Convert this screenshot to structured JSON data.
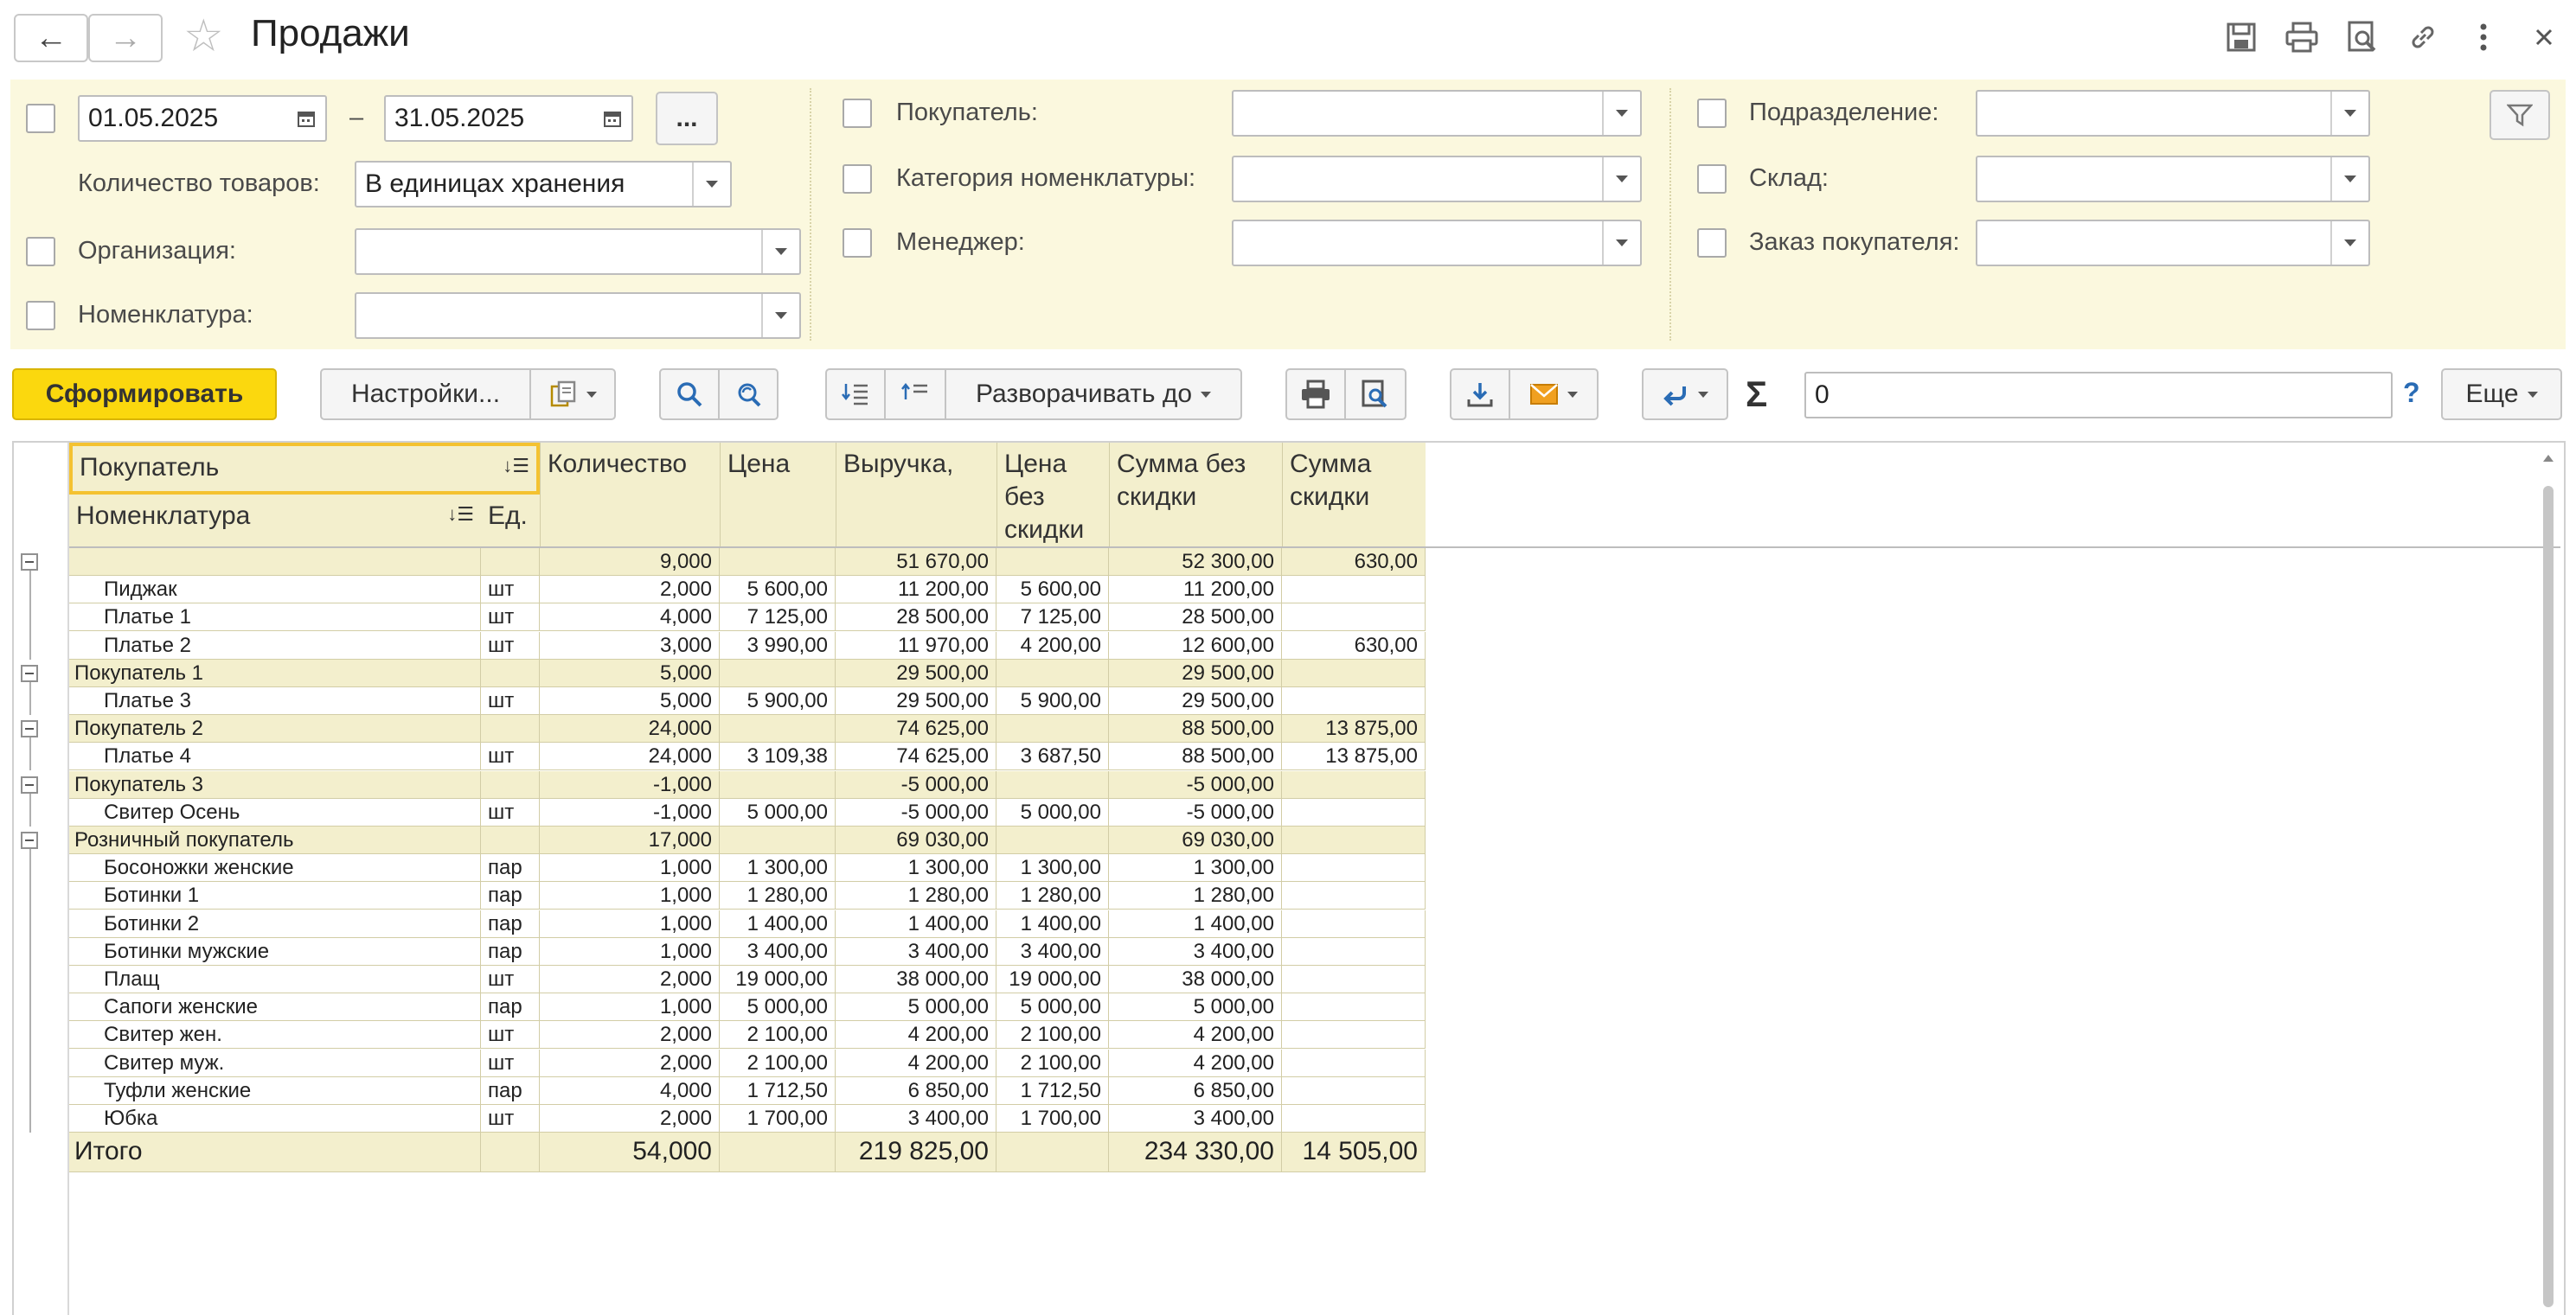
{
  "window": {
    "title": "Продажи"
  },
  "filters": {
    "period_from": "01.05.2025",
    "period_dash": "–",
    "period_to": "31.05.2025",
    "period_more": "...",
    "qty_label": "Количество товаров:",
    "qty_value": "В единицах хранения",
    "org_label": "Организация:",
    "org_value": "",
    "nom_label": "Номенклатура:",
    "nom_value": "",
    "buyer_label": "Покупатель:",
    "buyer_value": "",
    "category_label": "Категория номенклатуры:",
    "category_value": "",
    "manager_label": "Менеджер:",
    "manager_value": "",
    "division_label": "Подразделение:",
    "division_value": "",
    "warehouse_label": "Склад:",
    "warehouse_value": "",
    "order_label": "Заказ покупателя:",
    "order_value": ""
  },
  "toolbar": {
    "generate": "Сформировать",
    "settings": "Настройки...",
    "expand_to": "Разворачивать до",
    "sigma": "Σ",
    "sum_value": "0",
    "help": "?",
    "more": "Еще"
  },
  "report": {
    "headers": {
      "buyer": "Покупатель",
      "nomenclature": "Номенклатура",
      "unit": "Ед.",
      "qty": "Количество",
      "price": "Цена",
      "revenue": "Выручка,",
      "price_no_discount_1": "Цена",
      "price_no_discount_2": "без",
      "price_no_discount_3": "скидки",
      "sum_no_discount_1": "Сумма без",
      "sum_no_discount_2": "скидки",
      "discount_1": "Сумма",
      "discount_2": "скидки"
    },
    "rows": [
      {
        "type": "group",
        "name": "",
        "unit": "",
        "qty": "9,000",
        "price": "",
        "revenue": "51 670,00",
        "price_nd": "",
        "sum_nd": "52 300,00",
        "discount": "630,00"
      },
      {
        "type": "item",
        "name": "Пиджак",
        "unit": "шт",
        "qty": "2,000",
        "price": "5 600,00",
        "revenue": "11 200,00",
        "price_nd": "5 600,00",
        "sum_nd": "11 200,00",
        "discount": ""
      },
      {
        "type": "item",
        "name": "Платье 1",
        "unit": "шт",
        "qty": "4,000",
        "price": "7 125,00",
        "revenue": "28 500,00",
        "price_nd": "7 125,00",
        "sum_nd": "28 500,00",
        "discount": ""
      },
      {
        "type": "item",
        "name": "Платье 2",
        "unit": "шт",
        "qty": "3,000",
        "price": "3 990,00",
        "revenue": "11 970,00",
        "price_nd": "4 200,00",
        "sum_nd": "12 600,00",
        "discount": "630,00"
      },
      {
        "type": "group",
        "name": "Покупатель 1",
        "unit": "",
        "qty": "5,000",
        "price": "",
        "revenue": "29 500,00",
        "price_nd": "",
        "sum_nd": "29 500,00",
        "discount": ""
      },
      {
        "type": "item",
        "name": "Платье 3",
        "unit": "шт",
        "qty": "5,000",
        "price": "5 900,00",
        "revenue": "29 500,00",
        "price_nd": "5 900,00",
        "sum_nd": "29 500,00",
        "discount": ""
      },
      {
        "type": "group",
        "name": "Покупатель 2",
        "unit": "",
        "qty": "24,000",
        "price": "",
        "revenue": "74 625,00",
        "price_nd": "",
        "sum_nd": "88 500,00",
        "discount": "13 875,00"
      },
      {
        "type": "item",
        "name": "Платье 4",
        "unit": "шт",
        "qty": "24,000",
        "price": "3 109,38",
        "revenue": "74 625,00",
        "price_nd": "3 687,50",
        "sum_nd": "88 500,00",
        "discount": "13 875,00"
      },
      {
        "type": "group",
        "name": "Покупатель 3",
        "unit": "",
        "qty": "-1,000",
        "price": "",
        "revenue": "-5 000,00",
        "price_nd": "",
        "sum_nd": "-5 000,00",
        "discount": ""
      },
      {
        "type": "item",
        "name": "Свитер Осень",
        "unit": "шт",
        "qty": "-1,000",
        "price": "5 000,00",
        "revenue": "-5 000,00",
        "price_nd": "5 000,00",
        "sum_nd": "-5 000,00",
        "discount": ""
      },
      {
        "type": "group",
        "name": "Розничный покупатель",
        "unit": "",
        "qty": "17,000",
        "price": "",
        "revenue": "69 030,00",
        "price_nd": "",
        "sum_nd": "69 030,00",
        "discount": ""
      },
      {
        "type": "item",
        "name": "Босоножки женские",
        "unit": "пар",
        "qty": "1,000",
        "price": "1 300,00",
        "revenue": "1 300,00",
        "price_nd": "1 300,00",
        "sum_nd": "1 300,00",
        "discount": ""
      },
      {
        "type": "item",
        "name": "Ботинки 1",
        "unit": "пар",
        "qty": "1,000",
        "price": "1 280,00",
        "revenue": "1 280,00",
        "price_nd": "1 280,00",
        "sum_nd": "1 280,00",
        "discount": ""
      },
      {
        "type": "item",
        "name": "Ботинки 2",
        "unit": "пар",
        "qty": "1,000",
        "price": "1 400,00",
        "revenue": "1 400,00",
        "price_nd": "1 400,00",
        "sum_nd": "1 400,00",
        "discount": ""
      },
      {
        "type": "item",
        "name": "Ботинки мужские",
        "unit": "пар",
        "qty": "1,000",
        "price": "3 400,00",
        "revenue": "3 400,00",
        "price_nd": "3 400,00",
        "sum_nd": "3 400,00",
        "discount": ""
      },
      {
        "type": "item",
        "name": "Плащ",
        "unit": "шт",
        "qty": "2,000",
        "price": "19 000,00",
        "revenue": "38 000,00",
        "price_nd": "19 000,00",
        "sum_nd": "38 000,00",
        "discount": ""
      },
      {
        "type": "item",
        "name": "Сапоги женские",
        "unit": "пар",
        "qty": "1,000",
        "price": "5 000,00",
        "revenue": "5 000,00",
        "price_nd": "5 000,00",
        "sum_nd": "5 000,00",
        "discount": ""
      },
      {
        "type": "item",
        "name": "Свитер жен.",
        "unit": "шт",
        "qty": "2,000",
        "price": "2 100,00",
        "revenue": "4 200,00",
        "price_nd": "2 100,00",
        "sum_nd": "4 200,00",
        "discount": ""
      },
      {
        "type": "item",
        "name": "Свитер муж.",
        "unit": "шт",
        "qty": "2,000",
        "price": "2 100,00",
        "revenue": "4 200,00",
        "price_nd": "2 100,00",
        "sum_nd": "4 200,00",
        "discount": ""
      },
      {
        "type": "item",
        "name": "Туфли женские",
        "unit": "пар",
        "qty": "4,000",
        "price": "1 712,50",
        "revenue": "6 850,00",
        "price_nd": "1 712,50",
        "sum_nd": "6 850,00",
        "discount": ""
      },
      {
        "type": "item",
        "name": "Юбка",
        "unit": "шт",
        "qty": "2,000",
        "price": "1 700,00",
        "revenue": "3 400,00",
        "price_nd": "1 700,00",
        "sum_nd": "3 400,00",
        "discount": ""
      }
    ],
    "total": {
      "label": "Итого",
      "qty": "54,000",
      "revenue": "219 825,00",
      "sum_nd": "234 330,00",
      "discount": "14 505,00"
    }
  }
}
